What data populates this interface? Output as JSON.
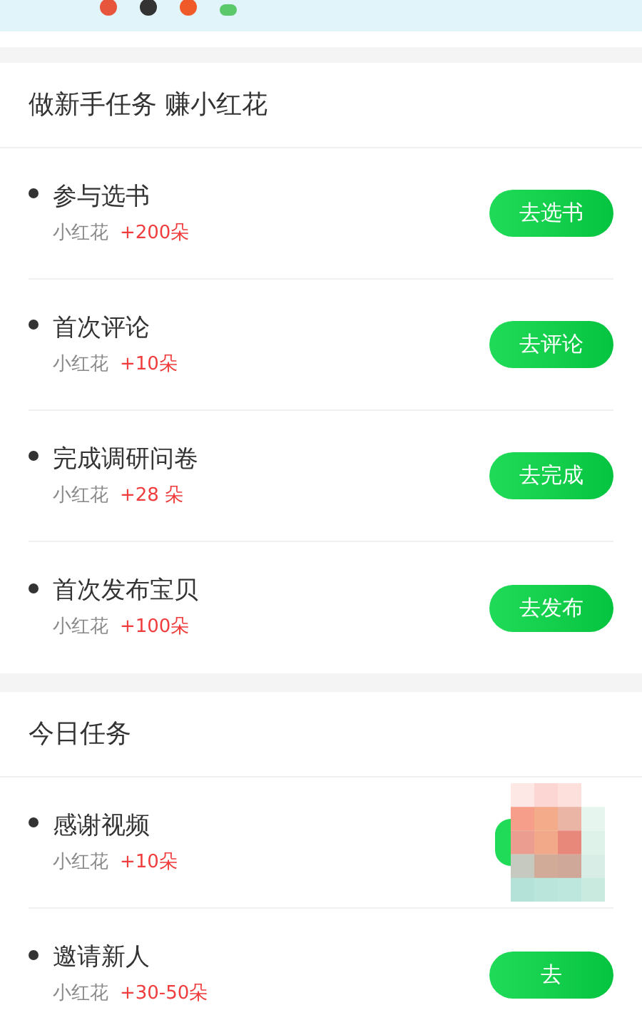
{
  "sections": [
    {
      "title": "做新手任务 赚小红花",
      "tasks": [
        {
          "name": "参与选书",
          "reward_label": "小红花",
          "reward": "+200朵",
          "button": "去选书"
        },
        {
          "name": "首次评论",
          "reward_label": "小红花",
          "reward": "+10朵",
          "button": "去评论"
        },
        {
          "name": "完成调研问卷",
          "reward_label": "小红花",
          "reward": "+28 朵",
          "button": "去完成"
        },
        {
          "name": "首次发布宝贝",
          "reward_label": "小红花",
          "reward": "+100朵",
          "button": "去发布"
        }
      ]
    },
    {
      "title": "今日任务",
      "tasks": [
        {
          "name": "感谢视频",
          "reward_label": "小红花",
          "reward": "+10朵",
          "covered": true
        },
        {
          "name": "邀请新人",
          "reward_label": "小红花",
          "reward": "+30-50朵",
          "button": "去"
        }
      ]
    }
  ]
}
